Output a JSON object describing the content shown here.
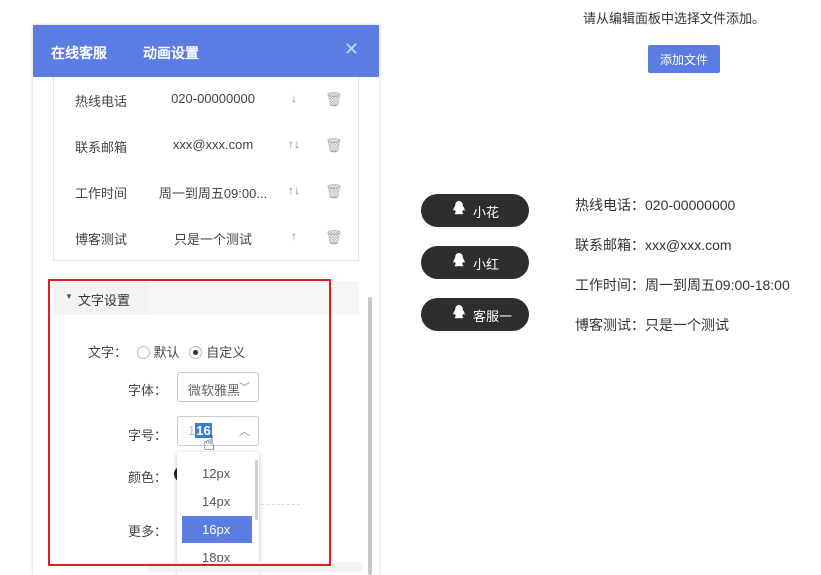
{
  "panel": {
    "tabs": [
      "在线客服",
      "动画设置"
    ],
    "close_icon": "close-icon",
    "contacts": [
      {
        "label": "热线电话",
        "value": "020-00000000",
        "arrows": "↓",
        "delete_icon": "trash-icon"
      },
      {
        "label": "联系邮箱",
        "value": "xxx@xxx.com",
        "arrows": "↑↓",
        "delete_icon": "trash-icon"
      },
      {
        "label": "工作时间",
        "value": "周一到周五09:00...",
        "arrows": "↑↓",
        "delete_icon": "trash-icon"
      },
      {
        "label": "博客测试",
        "value": "只是一个测试",
        "arrows": "↑",
        "delete_icon": "trash-icon"
      }
    ],
    "text_section": {
      "title": "文字设置",
      "text_label": "文字：",
      "radio_default": "默认",
      "radio_custom": "自定义",
      "selected_radio": "自定义",
      "font_label": "字体：",
      "font_value": "微软雅黑",
      "size_label": "字号：",
      "size_value": "16",
      "color_label": "颜色：",
      "more_label": "更多：",
      "size_options": [
        "12px",
        "14px",
        "16px",
        "18px"
      ],
      "selected_option": "16px"
    },
    "accent_color": "#5b7ce0",
    "highlight_color": "#e02020"
  },
  "preview": {
    "hint": "请从编辑面板中选择文件添加。",
    "add_button": "添加文件",
    "service_buttons": [
      "小花",
      "小红",
      "客服一"
    ],
    "service_icon": "qq-penguin-icon",
    "info_lines": [
      "热线电话：020-00000000",
      "联系邮箱：xxx@xxx.com",
      "工作时间：周一到周五09:00-18:00",
      "博客测试：只是一个测试"
    ]
  }
}
